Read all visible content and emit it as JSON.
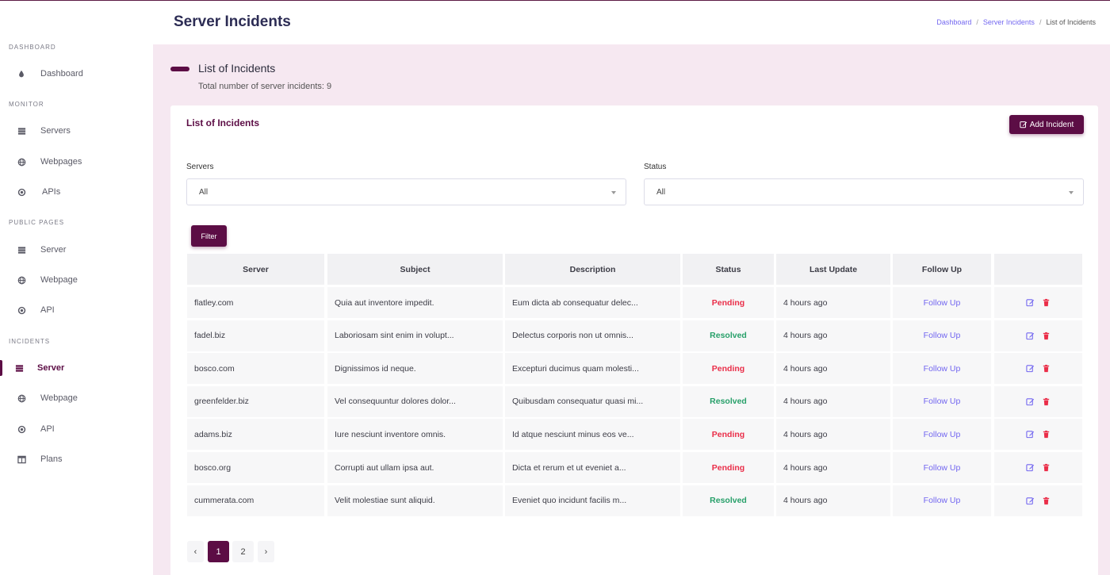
{
  "sidebar": {
    "sections": [
      {
        "title": "DASHBOARD",
        "items": [
          {
            "label": "Dashboard",
            "icon": "drop-icon"
          }
        ]
      },
      {
        "title": "MONITOR",
        "items": [
          {
            "label": "Servers",
            "icon": "server-icon"
          },
          {
            "label": "Webpages",
            "icon": "globe-icon"
          },
          {
            "label": "APIs",
            "icon": "target-icon"
          }
        ]
      },
      {
        "title": "PUBLIC PAGES",
        "items": [
          {
            "label": "Server",
            "icon": "server-icon"
          },
          {
            "label": "Webpage",
            "icon": "globe-icon"
          },
          {
            "label": "API",
            "icon": "target-icon"
          }
        ]
      },
      {
        "title": "INCIDENTS",
        "items": [
          {
            "label": "Server",
            "icon": "server-icon",
            "active": true
          },
          {
            "label": "Webpage",
            "icon": "globe-icon"
          },
          {
            "label": "API",
            "icon": "target-icon"
          },
          {
            "label": "Plans",
            "icon": "columns-icon"
          }
        ]
      }
    ]
  },
  "header": {
    "title": "Server Incidents",
    "breadcrumb": [
      "Dashboard",
      "Server Incidents",
      "List of Incidents"
    ]
  },
  "section": {
    "heading": "List of Incidents",
    "subtitle": "Total number of server incidents: 9"
  },
  "card": {
    "title": "List of Incidents",
    "add_label": "Add Incident",
    "filters": {
      "servers_label": "Servers",
      "servers_value": "All",
      "status_label": "Status",
      "status_value": "All",
      "filter_label": "Filter"
    }
  },
  "table": {
    "columns": [
      "Server",
      "Subject",
      "Description",
      "Status",
      "Last Update",
      "Follow Up",
      ""
    ],
    "rows": [
      {
        "server": "flatley.com",
        "subject": "Quia aut inventore impedit.",
        "description": "Eum dicta ab consequatur delec...",
        "status": "Pending",
        "last_update": "4 hours ago",
        "follow_up": "Follow Up"
      },
      {
        "server": "fadel.biz",
        "subject": "Laboriosam sint enim in volupt...",
        "description": "Delectus corporis non ut omnis...",
        "status": "Resolved",
        "last_update": "4 hours ago",
        "follow_up": "Follow Up"
      },
      {
        "server": "bosco.com",
        "subject": "Dignissimos id neque.",
        "description": "Excepturi ducimus quam molesti...",
        "status": "Pending",
        "last_update": "4 hours ago",
        "follow_up": "Follow Up"
      },
      {
        "server": "greenfelder.biz",
        "subject": "Vel consequuntur dolores dolor...",
        "description": "Quibusdam consequatur quasi mi...",
        "status": "Resolved",
        "last_update": "4 hours ago",
        "follow_up": "Follow Up"
      },
      {
        "server": "adams.biz",
        "subject": "Iure nesciunt inventore omnis.",
        "description": "Id atque nesciunt minus eos ve...",
        "status": "Pending",
        "last_update": "4 hours ago",
        "follow_up": "Follow Up"
      },
      {
        "server": "bosco.org",
        "subject": "Corrupti aut ullam ipsa aut.",
        "description": "Dicta et rerum et ut eveniet a...",
        "status": "Pending",
        "last_update": "4 hours ago",
        "follow_up": "Follow Up"
      },
      {
        "server": "cummerata.com",
        "subject": "Velit molestiae sunt aliquid.",
        "description": "Eveniet quo incidunt facilis m...",
        "status": "Resolved",
        "last_update": "4 hours ago",
        "follow_up": "Follow Up"
      }
    ]
  },
  "pagination": {
    "prev": "‹",
    "pages": [
      "1",
      "2"
    ],
    "current": "1",
    "next": "›"
  },
  "colors": {
    "brand": "#5c0d45",
    "link": "#7367f0",
    "pending": "#ea2e49",
    "resolved": "#28a06a",
    "delete": "#ea2e49"
  }
}
